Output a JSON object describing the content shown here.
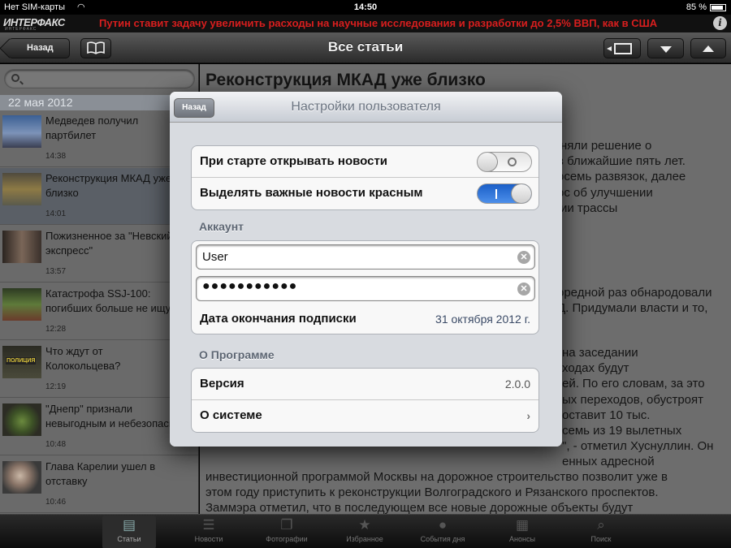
{
  "status_bar": {
    "carrier": "Нет SIM-карты",
    "time": "14:50",
    "battery": "85 %"
  },
  "ticker": {
    "logo": "ИНТЕРФАКС",
    "logo_sub": "ИНТЕРФАКС",
    "headline": "Путин ставит задачу увеличить расходы на научные исследования и разработки до 2,5% ВВП, как в США",
    "headline_color": "#d81e1e"
  },
  "navbar": {
    "back_label": "Назад",
    "title": "Все статьи"
  },
  "sidebar": {
    "search_placeholder": "",
    "date_header": "22 мая 2012",
    "articles": [
      {
        "title": "Медведев получил\nпартбилет",
        "time": "14:38",
        "selected": false
      },
      {
        "title": "Реконструкция МКАД уже\nблизко",
        "time": "14:01",
        "selected": true
      },
      {
        "title": "Пожизненное за \"Невский\nэкспресс\"",
        "time": "13:57",
        "selected": false
      },
      {
        "title": "Катастрофа SSJ-100:\nпогибших больше не ищут",
        "time": "12:28",
        "selected": false
      },
      {
        "title": "Что ждут от\nКолокольцева?",
        "time": "12:19",
        "selected": false
      },
      {
        "title": "\"Днепр\" признали\nневыгодным и небезопасным",
        "time": "10:48",
        "selected": false
      },
      {
        "title": "Глава Карелии ушел в\nотставку",
        "time": "10:46",
        "selected": false
      }
    ]
  },
  "article": {
    "title": "Реконструкция МКАД уже близко",
    "lines": [
      "няли решение о",
      "в ближайшие пять лет.",
      "осемь развязок, далее",
      "ос об улучшении",
      "ии трассы",
      "оредной раз обнародовали",
      "Д. Придумали власти и то,",
      "на заседании",
      "ходах будут",
      "ей. По его словам, за это",
      "ых переходов, обустроят",
      "оставит 10 тыс.",
      "семь из 19 вылетных",
      "\", - отметил Хуснуллин. Он",
      "енных адресной",
      "инвестиционной программой Москвы на дорожное строительство позволит уже в",
      "этом году приступить к реконструкции Волгоградского и Рязанского проспектов.",
      "Заммэра отметил, что в последующем все новые дорожные объекты будут"
    ]
  },
  "modal": {
    "back_label": "Назад",
    "title": "Настройки пользователя",
    "toggles": [
      {
        "label": "При старте открывать новости",
        "state": "off"
      },
      {
        "label": "Выделять важные новости красным",
        "state": "on"
      }
    ],
    "account": {
      "header": "Аккаунт",
      "username": "User",
      "password_mask": "●●●●●●●●●●●",
      "subscription_label": "Дата окончания подписки",
      "subscription_value": "31 октября 2012 г."
    },
    "about": {
      "header": "О Программе",
      "version_label": "Версия",
      "version_value": "2.0.0",
      "system_label": "О системе"
    }
  },
  "tabbar": {
    "tabs": [
      {
        "label": "Статьи",
        "icon": "articles-icon",
        "active": true
      },
      {
        "label": "Новости",
        "icon": "news-icon",
        "active": false
      },
      {
        "label": "Фотографии",
        "icon": "photos-icon",
        "active": false
      },
      {
        "label": "Избранное",
        "icon": "star-icon",
        "active": false
      },
      {
        "label": "События дня",
        "icon": "lightbulb-icon",
        "active": false
      },
      {
        "label": "Анонсы",
        "icon": "calendar-icon",
        "active": false
      },
      {
        "label": "Поиск",
        "icon": "search-icon",
        "active": false
      }
    ]
  }
}
